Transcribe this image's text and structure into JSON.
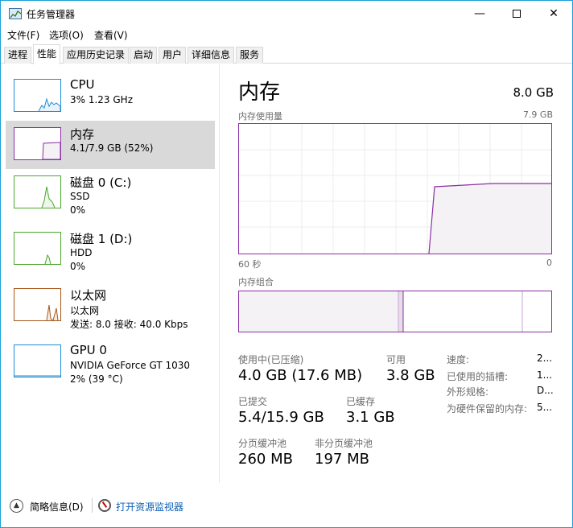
{
  "window": {
    "title": "任务管理器"
  },
  "menu": [
    "文件(F)",
    "选项(O)",
    "查看(V)"
  ],
  "tabs": [
    "进程",
    "性能",
    "应用历史记录",
    "启动",
    "用户",
    "详细信息",
    "服务"
  ],
  "active_tab": "性能",
  "resources": [
    {
      "name": "CPU",
      "line2": "3% 1.23 GHz",
      "line3": "",
      "color": "#1f8dd6"
    },
    {
      "name": "内存",
      "line2": "4.1/7.9 GB (52%)",
      "line3": "",
      "color": "#8b2fa6",
      "selected": true
    },
    {
      "name": "磁盘 0 (C:)",
      "line2": "SSD",
      "line3": "0%",
      "color": "#4ca72f"
    },
    {
      "name": "磁盘 1 (D:)",
      "line2": "HDD",
      "line3": "0%",
      "color": "#4ca72f"
    },
    {
      "name": "以太网",
      "line2": "以太网",
      "line3": "发送: 8.0  接收: 40.0 Kbps",
      "color": "#a7581c"
    },
    {
      "name": "GPU 0",
      "line2": "NVIDIA GeForce GT 1030",
      "line3": "2% (39 °C)",
      "color": "#1f8dd6"
    }
  ],
  "detail": {
    "title": "内存",
    "total": "8.0 GB",
    "usage_label": "内存使用量",
    "usage_max": "7.9 GB",
    "axis_left": "60 秒",
    "axis_right": "0",
    "composition_label": "内存组合",
    "stats": {
      "in_use_label": "使用中(已压缩)",
      "in_use_value": "4.0 GB (17.6 MB)",
      "available_label": "可用",
      "available_value": "3.8 GB",
      "committed_label": "已提交",
      "committed_value": "5.4/15.9 GB",
      "cached_label": "已缓存",
      "cached_value": "3.1 GB",
      "paged_label": "分页缓冲池",
      "paged_value": "260 MB",
      "nonpaged_label": "非分页缓冲池",
      "nonpaged_value": "197 MB"
    },
    "side": {
      "speed_label": "速度:",
      "speed_value": "2...",
      "slots_label": "已使用的插槽:",
      "slots_value": "1...",
      "form_label": "外形规格:",
      "form_value": "D...",
      "reserved_label": "为硬件保留的内存:",
      "reserved_value": "5..."
    }
  },
  "bottom": {
    "fewer_details": "简略信息(D)",
    "open_monitor": "打开资源监视器"
  },
  "colors": {
    "memory": "#8b2fa6",
    "memory_fill": "#f4f2f4",
    "accent": "#1aa0d8",
    "link": "#0b5fb3"
  }
}
